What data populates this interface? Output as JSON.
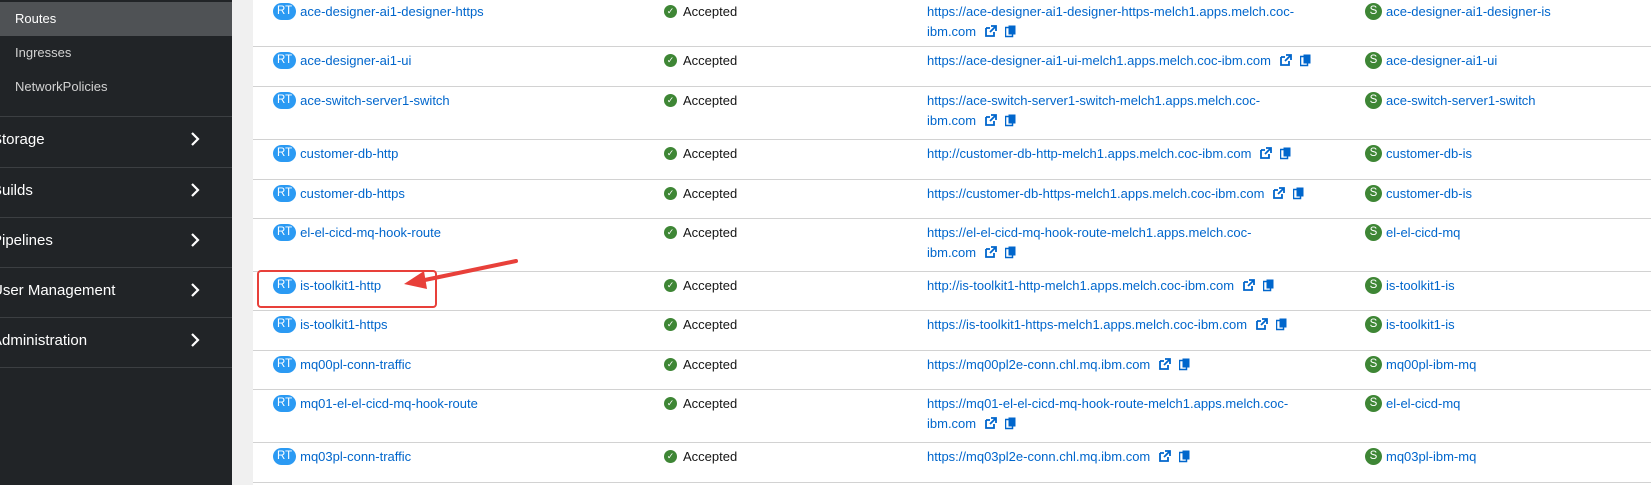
{
  "sidebar": {
    "sub_items": [
      {
        "label": "Routes",
        "active": true
      },
      {
        "label": "Ingresses",
        "active": false
      },
      {
        "label": "NetworkPolicies",
        "active": false
      }
    ],
    "sections": [
      {
        "label": "Storage"
      },
      {
        "label": "Builds"
      },
      {
        "label": "Pipelines"
      },
      {
        "label": "User Management"
      },
      {
        "label": "Administration"
      }
    ]
  },
  "routes": {
    "resource_badge": "RT",
    "service_badge": "S",
    "rows": [
      {
        "name": "ace-designer-ai1-designer-https",
        "status": "Accepted",
        "location_line1": "https://ace-designer-ai1-designer-https-melch1.apps.melch.coc-",
        "location_line2": "ibm.com",
        "service": "ace-designer-ai1-designer-is"
      },
      {
        "name": "ace-designer-ai1-ui",
        "status": "Accepted",
        "location_line1": "https://ace-designer-ai1-ui-melch1.apps.melch.coc-ibm.com",
        "location_line2": "",
        "service": "ace-designer-ai1-ui"
      },
      {
        "name": "ace-switch-server1-switch",
        "status": "Accepted",
        "location_line1": "https://ace-switch-server1-switch-melch1.apps.melch.coc-",
        "location_line2": "ibm.com",
        "service": "ace-switch-server1-switch"
      },
      {
        "name": "customer-db-http",
        "status": "Accepted",
        "location_line1": "http://customer-db-http-melch1.apps.melch.coc-ibm.com",
        "location_line2": "",
        "service": "customer-db-is"
      },
      {
        "name": "customer-db-https",
        "status": "Accepted",
        "location_line1": "https://customer-db-https-melch1.apps.melch.coc-ibm.com",
        "location_line2": "",
        "service": "customer-db-is"
      },
      {
        "name": "el-el-cicd-mq-hook-route",
        "status": "Accepted",
        "location_line1": "https://el-el-cicd-mq-hook-route-melch1.apps.melch.coc-",
        "location_line2": "ibm.com",
        "service": "el-el-cicd-mq"
      },
      {
        "name": "is-toolkit1-http",
        "status": "Accepted",
        "location_line1": "http://is-toolkit1-http-melch1.apps.melch.coc-ibm.com",
        "location_line2": "",
        "service": "is-toolkit1-is"
      },
      {
        "name": "is-toolkit1-https",
        "status": "Accepted",
        "location_line1": "https://is-toolkit1-https-melch1.apps.melch.coc-ibm.com",
        "location_line2": "",
        "service": "is-toolkit1-is"
      },
      {
        "name": "mq00pl-conn-traffic",
        "status": "Accepted",
        "location_line1": "https://mq00pl2e-conn.chl.mq.ibm.com",
        "location_line2": "",
        "service": "mq00pl-ibm-mq"
      },
      {
        "name": "mq01-el-el-cicd-mq-hook-route",
        "status": "Accepted",
        "location_line1": "https://mq01-el-el-cicd-mq-hook-route-melch1.apps.melch.coc-",
        "location_line2": "ibm.com",
        "service": "el-el-cicd-mq"
      },
      {
        "name": "mq03pl-conn-traffic",
        "status": "Accepted",
        "location_line1": "https://mq03pl2e-conn.chl.mq.ibm.com",
        "location_line2": "",
        "service": "mq03pl-ibm-mq"
      }
    ]
  },
  "icons": {
    "status": "check-circle-icon",
    "external_link": "external-link-icon",
    "copy": "copy-icon",
    "chevron": "chevron-right-icon"
  },
  "colors": {
    "sidebar_bg": "#212427",
    "active_item_bg": "#4f5255",
    "link": "#0066cc",
    "rt_badge": "#2b9af3",
    "success": "#3e8635",
    "highlight": "#e8403a"
  }
}
